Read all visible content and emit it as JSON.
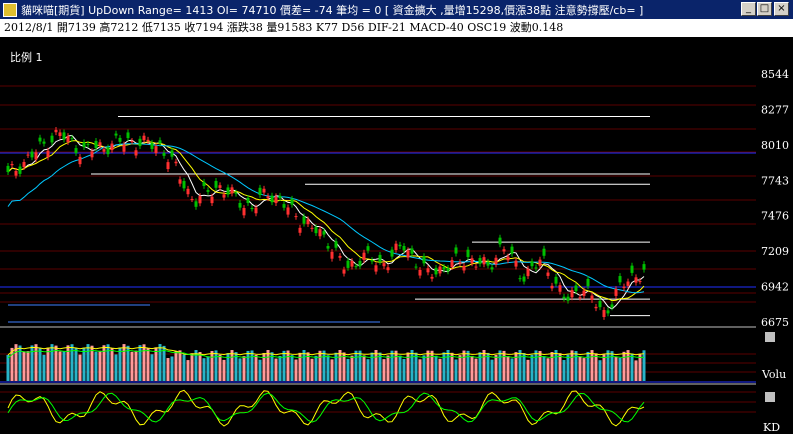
{
  "window": {
    "title": "貓咪喵[期貨]    UpDown Range= 1413  OI= 74710 價差= -74  筆均 = 0 [ 資金擴大 ,量增15298,價漲38點 注意勢撐壓/cb= ]",
    "min_label": "_",
    "max_label": "□",
    "close_label": "×"
  },
  "infobar": {
    "text": "2012/8/1  開7139  高7212  低7135  收7194  漲跌38  量91583  K77  D56  DIF-21  MACD-40  OSC19  波動0.148"
  },
  "chart_data": [
    {
      "type": "candlestick",
      "title": "比例 1",
      "price_ticks": [
        8544,
        8277,
        8010,
        7743,
        7476,
        7209,
        6942,
        6675
      ],
      "ylim": [
        6675,
        8544
      ],
      "resistance_lines": [
        8224,
        7713,
        7277,
        6847,
        6723
      ],
      "colors": {
        "up": "#ff3030",
        "down": "#00c000",
        "ma_short": "#ffffff",
        "ma_mid": "#ffff00",
        "ma_long": "#00c8ff"
      }
    },
    {
      "type": "bar",
      "label": "Volu",
      "colors": {
        "up": "#ff9a9a",
        "down": "#28b4c8",
        "ma1": "#ffff00",
        "ma2": "#00ff00"
      }
    },
    {
      "type": "line",
      "label": "KD",
      "series_colors": [
        "#ffff00",
        "#00ff00"
      ]
    }
  ]
}
